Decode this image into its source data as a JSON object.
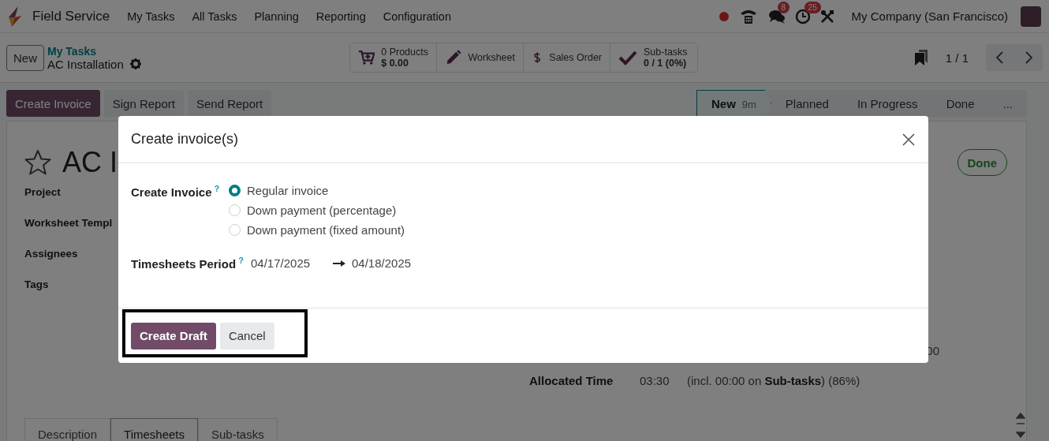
{
  "navbar": {
    "app_name": "Field Service",
    "menu": [
      "My Tasks",
      "All Tasks",
      "Planning",
      "Reporting",
      "Configuration"
    ],
    "messages_badge": "8",
    "activities_badge": "25",
    "company": "My Company (San Francisco)"
  },
  "control_panel": {
    "new_button": "New",
    "breadcrumb": "My Tasks",
    "record_name": "AC Installation",
    "stat_buttons": [
      {
        "kind": "products",
        "lines": [
          "0 Products",
          "$ 0.00"
        ]
      },
      {
        "kind": "worksheet",
        "lines": [
          "Worksheet"
        ]
      },
      {
        "kind": "sales",
        "lines": [
          "Sales Order"
        ]
      },
      {
        "kind": "subtasks",
        "lines": [
          "Sub-tasks",
          "0 / 1 (0%)"
        ]
      }
    ],
    "pager": "1 / 1"
  },
  "actions": [
    {
      "label": "Create Invoice",
      "primary": true
    },
    {
      "label": "Sign Report",
      "primary": false
    },
    {
      "label": "Send Report",
      "primary": false
    }
  ],
  "stages": [
    {
      "label": "New",
      "duration": "9m",
      "selected": true
    },
    {
      "label": "Planned",
      "selected": false
    },
    {
      "label": "In Progress",
      "selected": false
    },
    {
      "label": "Done",
      "selected": false
    }
  ],
  "stages_more": "...",
  "form": {
    "title": "AC I",
    "starred": false,
    "done_button": "Done",
    "fields": [
      "Project",
      "Worksheet Templ",
      "Assignees",
      "Tags"
    ],
    "partial_value": "00",
    "allocated": {
      "label": "Allocated Time",
      "value": "03:30",
      "note": "(incl. 00:00 on **Sub-tasks**) (86%)"
    },
    "tabs": [
      {
        "label": "Description",
        "selected": false
      },
      {
        "label": "Timesheets",
        "selected": true
      },
      {
        "label": "Sub-tasks",
        "selected": false
      }
    ]
  },
  "dialog": {
    "title": "Create invoice(s)",
    "invoice_label": "Create Invoice",
    "invoice_help": "?",
    "options": [
      {
        "label": "Regular invoice",
        "selected": true
      },
      {
        "label": "Down payment (percentage)",
        "selected": false
      },
      {
        "label": "Down payment (fixed amount)",
        "selected": false
      }
    ],
    "period_label": "Timesheets Period",
    "period_help": "?",
    "date_from": "04/17/2025",
    "date_to": "04/18/2025",
    "buttons": [
      {
        "label": "Create Draft",
        "primary": true
      },
      {
        "label": "Cancel",
        "primary": false
      }
    ],
    "highlighted": true
  }
}
